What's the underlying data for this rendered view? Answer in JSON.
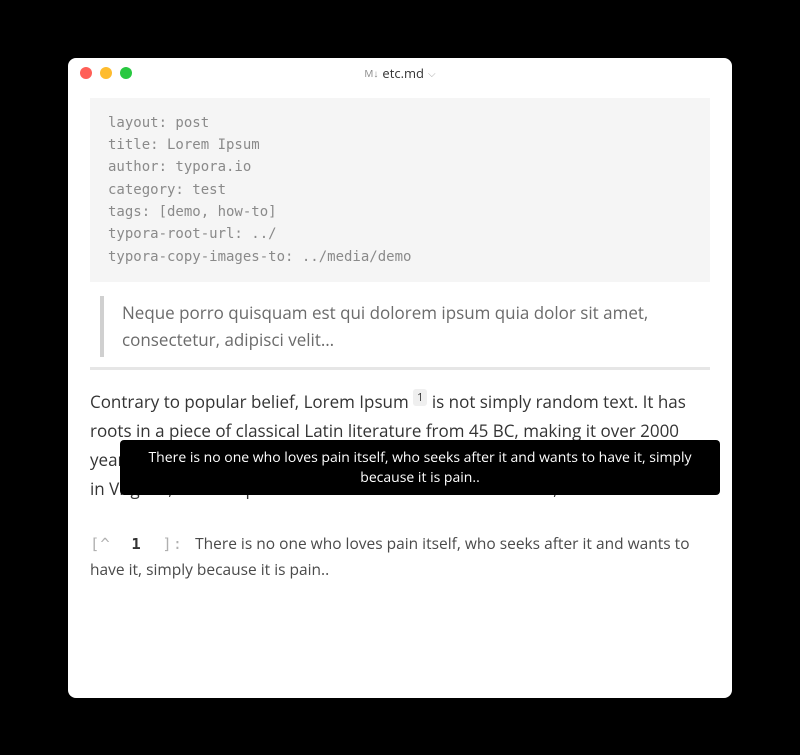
{
  "titlebar": {
    "filename": "etc.md"
  },
  "frontmatter": {
    "text": "layout: post\ntitle: Lorem Ipsum\nauthor: typora.io\ncategory: test\ntags: [demo, how-to]\ntypora-root-url: ../\ntypora-copy-images-to: ../media/demo"
  },
  "blockquote": {
    "text": "Neque porro quisquam est qui dolorem ipsum quia dolor sit amet, consectetur, adipisci velit…"
  },
  "paragraph": {
    "part1": "Contrary to popular belief, Lorem Ipsum ",
    "footnote_ref": "1",
    "part2": "  is not simply random text. It has roots in a piece of classical Latin literature from 45 BC, making it over 2000 years old. Richard McClintock, a Latin professor at Hampden-Sydney College in Virginia, looked up one of the more obscure Latin words, consectetur."
  },
  "tooltip": {
    "text": "There is no one who loves pain itself, who seeks after it and wants to have it, simply because it is pain.."
  },
  "footnote": {
    "marker_open": "[^",
    "marker_num": "1",
    "marker_close": "]:",
    "text": "There is no one who loves pain itself, who seeks after it and wants to have it, simply because it is pain.."
  }
}
